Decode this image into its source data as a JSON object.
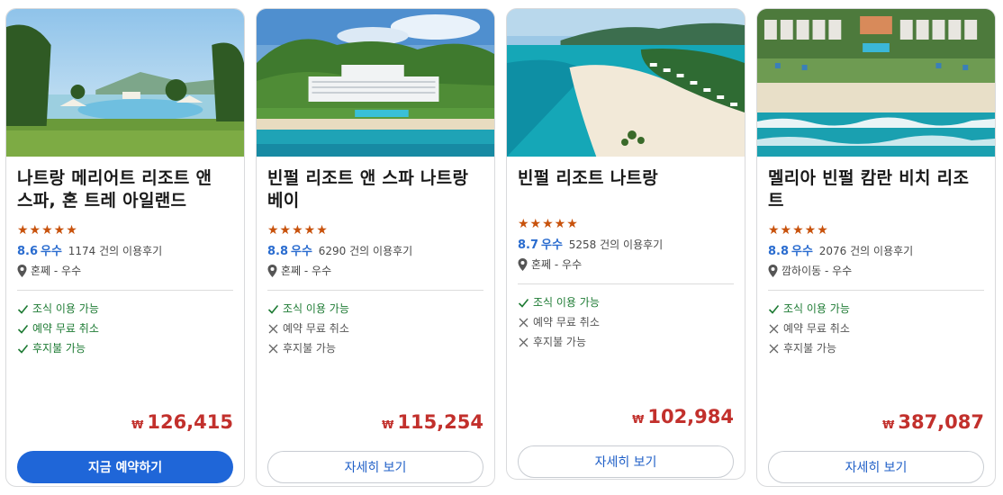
{
  "colors": {
    "accent": "#1f66d8",
    "rating": "#2a6ccf",
    "price": "#c2302c",
    "star": "#c8520c",
    "ok": "#1e7b34"
  },
  "cards": [
    {
      "name": "나트랑 메리어트 리조트 앤 스파, 혼 트레 아일랜드",
      "stars": "★★★★★",
      "score": "8.6",
      "grade": "우수",
      "review_count": "1174",
      "review_suffix": " 건의 이용후기",
      "location": "혼쩨 - 우수",
      "features": [
        {
          "label": "조식 이용 가능",
          "icon": "check-icon"
        },
        {
          "label": "예약 무료 취소",
          "icon": "check-icon"
        },
        {
          "label": "후지불 가능",
          "icon": "check-icon"
        }
      ],
      "currency": "₩",
      "price": "126,415",
      "button": "지금 예약하기"
    },
    {
      "name": "빈펄 리조트 앤 스파 나트랑 베이",
      "stars": "★★★★★",
      "score": "8.8",
      "grade": "우수",
      "review_count": "6290",
      "review_suffix": " 건의 이용후기",
      "location": "혼쩨 - 우수",
      "features": [
        {
          "label": "조식 이용 가능",
          "icon": "check-icon"
        },
        {
          "label": "예약 무료 취소",
          "icon": "cross-icon"
        },
        {
          "label": "후지불 가능",
          "icon": "cross-icon"
        }
      ],
      "currency": "₩",
      "price": "115,254",
      "button": "자세히 보기"
    },
    {
      "name": "빈펄 리조트 나트랑",
      "stars": "★★★★★",
      "score": "8.7",
      "grade": "우수",
      "review_count": "5258",
      "review_suffix": " 건의 이용후기",
      "location": "혼쩨 - 우수",
      "features": [
        {
          "label": "조식 이용 가능",
          "icon": "check-icon"
        },
        {
          "label": "예약 무료 취소",
          "icon": "cross-icon"
        },
        {
          "label": "후지불 가능",
          "icon": "cross-icon"
        }
      ],
      "currency": "₩",
      "price": "102,984",
      "button": "자세히 보기"
    },
    {
      "name": "멜리아 빈펄 캄란 비치 리조트",
      "stars": "★★★★★",
      "score": "8.8",
      "grade": "우수",
      "review_count": "2076",
      "review_suffix": " 건의 이용후기",
      "location": "깜하이동 - 우수",
      "features": [
        {
          "label": "조식 이용 가능",
          "icon": "check-icon"
        },
        {
          "label": "예약 무료 취소",
          "icon": "cross-icon"
        },
        {
          "label": "후지불 가능",
          "icon": "cross-icon"
        }
      ],
      "currency": "₩",
      "price": "387,087",
      "button": "자세히 보기"
    }
  ]
}
